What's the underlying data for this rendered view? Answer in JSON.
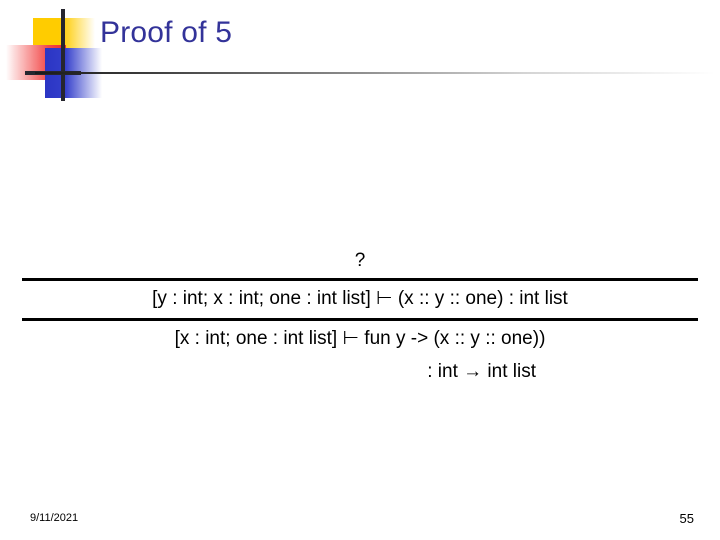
{
  "slide": {
    "title": "Proof of 5",
    "title_color": "#333399",
    "background_color": "#ffffff"
  },
  "logo": {
    "yellow_color": "#ffcc00",
    "red_color": "#f02b2b",
    "blue_color": "#2b35c4",
    "line_color": "#26262e"
  },
  "proof": {
    "premise_placeholder": "?",
    "conclusion_upper": "[y : int; x : int; one : int list] ⊢ (x :: y :: one) : int list",
    "conclusion_lower": "[x : int; one : int list] ⊢ fun y -> (x :: y :: one))",
    "type_annotation": ": int → int list"
  },
  "footer": {
    "date": "9/11/2021",
    "slide_number": "55"
  }
}
